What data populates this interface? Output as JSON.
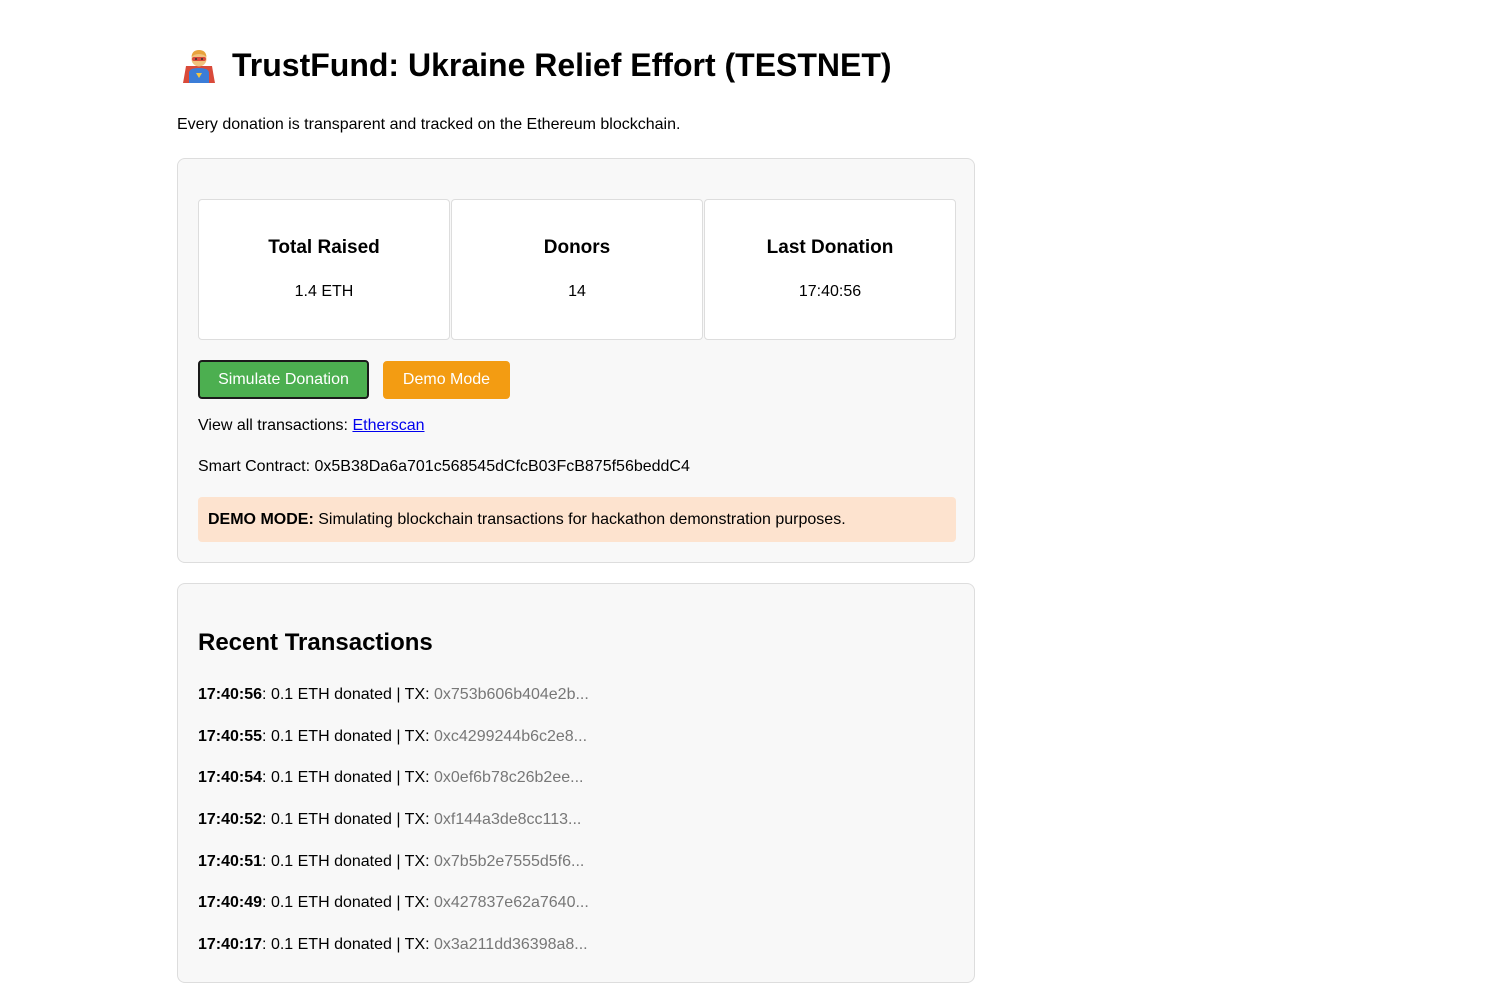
{
  "header": {
    "icon": "superhero-emoji-icon",
    "title": "TrustFund: Ukraine Relief Effort (TESTNET)",
    "subtitle": "Every donation is transparent and tracked on the Ethereum blockchain."
  },
  "stats": {
    "total_raised_label": "Total Raised",
    "total_raised_value": "1.4 ETH",
    "donors_label": "Donors",
    "donors_value": "14",
    "last_donation_label": "Last Donation",
    "last_donation_value": "17:40:56"
  },
  "actions": {
    "simulate_label": "Simulate Donation",
    "demo_label": "Demo Mode"
  },
  "links": {
    "view_all_prefix": "View all transactions: ",
    "etherscan_label": "Etherscan",
    "contract_prefix": "Smart Contract: ",
    "contract_address": "0x5B38Da6a701c568545dCfcB03FcB875f56beddC4"
  },
  "notice": {
    "strong": "DEMO MODE:",
    "text": " Simulating blockchain transactions for hackathon demonstration purposes."
  },
  "transactions": {
    "heading": "Recent Transactions",
    "items": [
      {
        "time": "17:40:56",
        "text": ": 0.1 ETH donated | TX: ",
        "hash": "0x753b606b404e2b..."
      },
      {
        "time": "17:40:55",
        "text": ": 0.1 ETH donated | TX: ",
        "hash": "0xc4299244b6c2e8..."
      },
      {
        "time": "17:40:54",
        "text": ": 0.1 ETH donated | TX: ",
        "hash": "0x0ef6b78c26b2ee..."
      },
      {
        "time": "17:40:52",
        "text": ": 0.1 ETH donated | TX: ",
        "hash": "0xf144a3de8cc113..."
      },
      {
        "time": "17:40:51",
        "text": ": 0.1 ETH donated | TX: ",
        "hash": "0x7b5b2e7555d5f6..."
      },
      {
        "time": "17:40:49",
        "text": ": 0.1 ETH donated | TX: ",
        "hash": "0x427837e62a7640..."
      },
      {
        "time": "17:40:17",
        "text": ": 0.1 ETH donated | TX: ",
        "hash": "0x3a211dd36398a8..."
      }
    ]
  },
  "colors": {
    "primary_button": "#4caf50",
    "secondary_button": "#f39c12",
    "notice_background": "#fde3cf",
    "hash_text": "#777777"
  }
}
